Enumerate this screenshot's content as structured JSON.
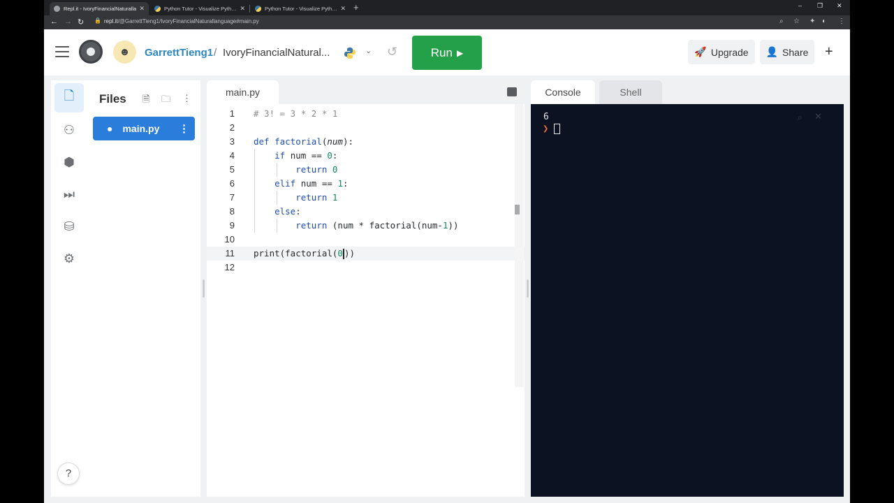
{
  "browser": {
    "tabs": [
      {
        "title": "Repl.it - IvoryFinancialNaturalla",
        "active": true
      },
      {
        "title": "Python Tutor - Visualize Python,",
        "active": false
      },
      {
        "title": "Python Tutor - Visualize Python,",
        "active": false
      }
    ],
    "new_tab": "+",
    "url_host": "repl.it",
    "url_path": "/@GarrettTieng1/IvoryFinancialNaturallanguage#main.py",
    "window_controls": {
      "minimize": "–",
      "restore": "❐",
      "close": "✕"
    }
  },
  "header": {
    "username": "GarrettTieng1",
    "separator": "/",
    "repl_name": "IvoryFinancialNatural...",
    "run_label": "Run",
    "upgrade_label": "Upgrade",
    "share_label": "Share",
    "add_label": "+"
  },
  "files": {
    "title": "Files",
    "items": [
      {
        "name": "main.py",
        "active": true
      }
    ]
  },
  "editor": {
    "tab": "main.py",
    "current_line": 11,
    "lines": [
      {
        "n": "1",
        "text": "# 3! = 3 * 2 * 1"
      },
      {
        "n": "2",
        "text": ""
      },
      {
        "n": "3",
        "text": "def factorial(num):"
      },
      {
        "n": "4",
        "text": "    if num == 0:"
      },
      {
        "n": "5",
        "text": "        return 0"
      },
      {
        "n": "6",
        "text": "    elif num == 1:"
      },
      {
        "n": "7",
        "text": "        return 1"
      },
      {
        "n": "8",
        "text": "    else:"
      },
      {
        "n": "9",
        "text": "        return (num * factorial(num-1))"
      },
      {
        "n": "10",
        "text": ""
      },
      {
        "n": "11",
        "text": "print(factorial(0))"
      },
      {
        "n": "12",
        "text": ""
      }
    ]
  },
  "console": {
    "tabs": [
      "Console",
      "Shell"
    ],
    "output": "6",
    "prompt_icon": "chevron-right-icon"
  },
  "help_label": "?",
  "colors": {
    "run": "#24a148",
    "accent": "#2a7ddb",
    "console_bg": "#0d1222",
    "prompt": "#f26b3a"
  }
}
